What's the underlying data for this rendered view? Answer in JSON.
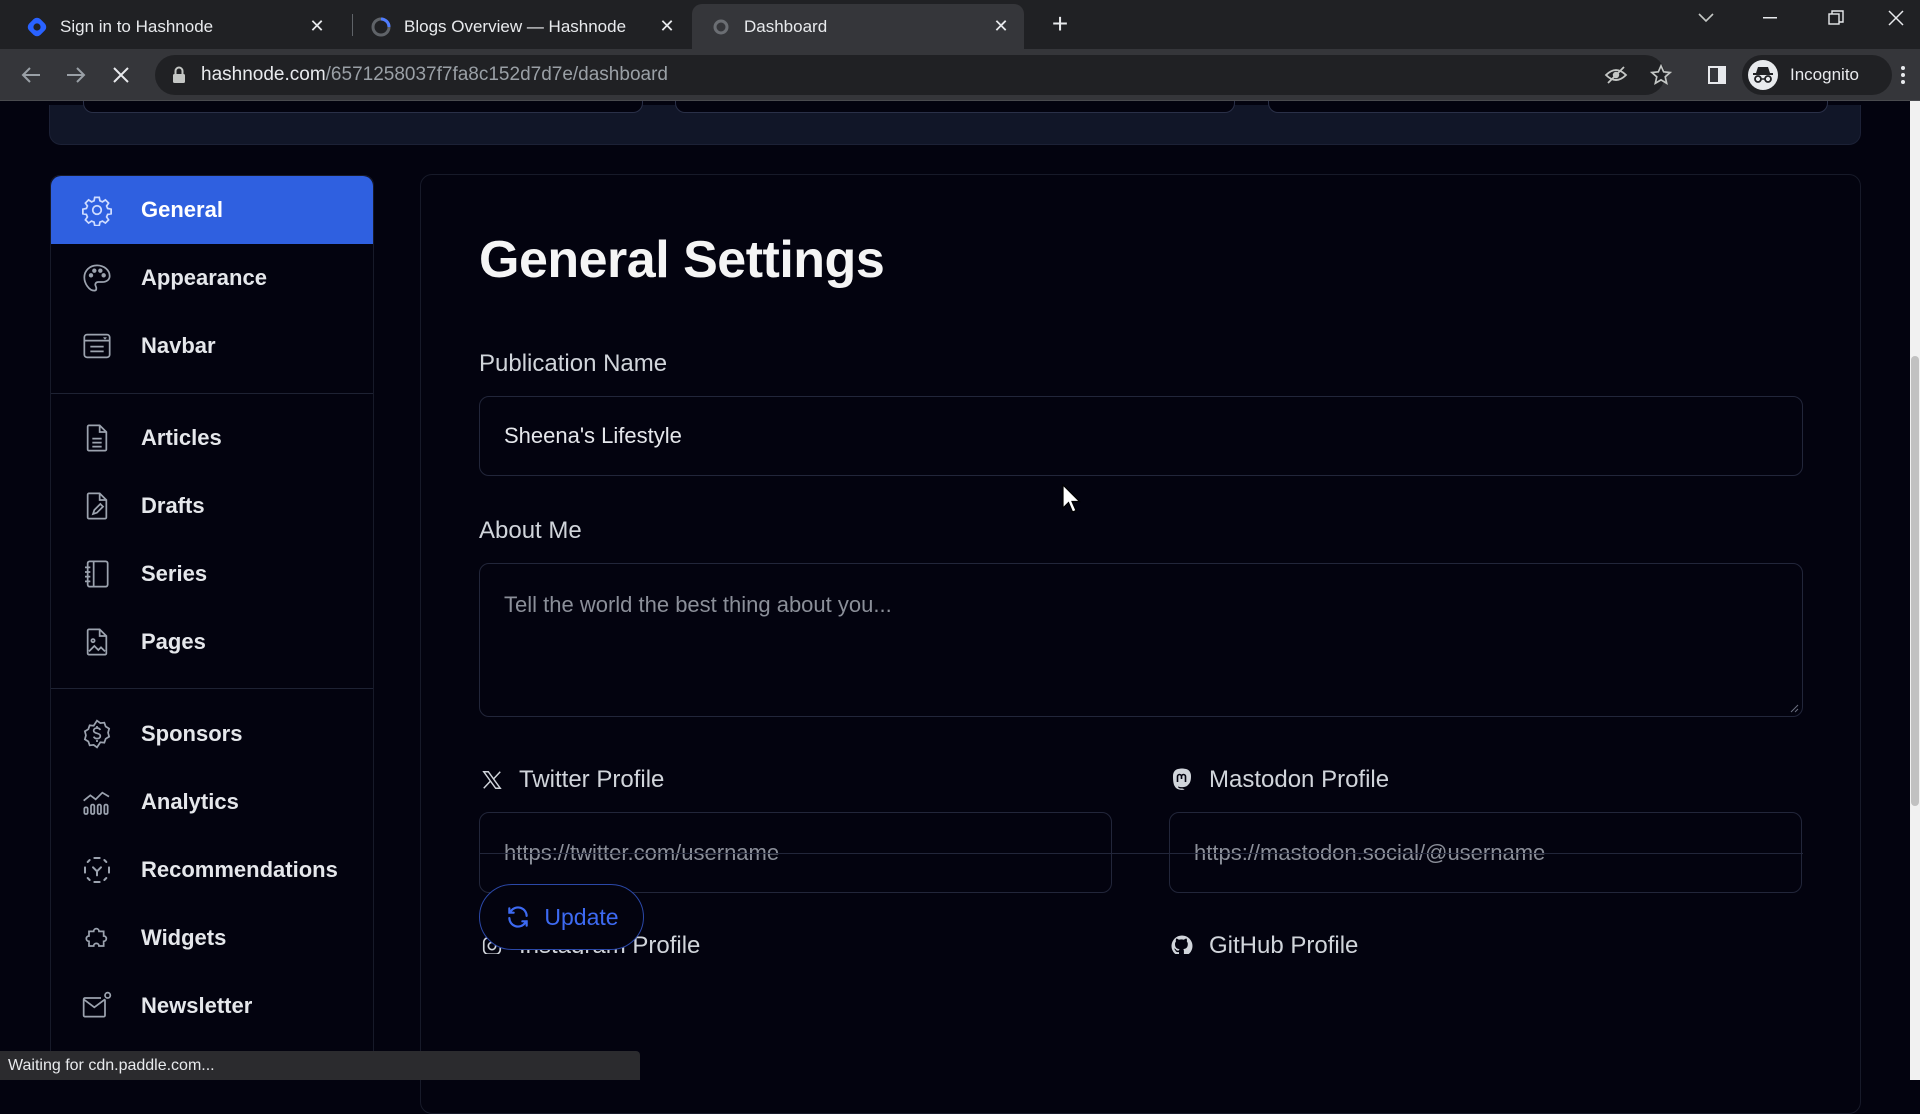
{
  "browser": {
    "tabs": [
      {
        "title": "Sign in to Hashnode",
        "icon": "hashnode-logo-icon",
        "active": false
      },
      {
        "title": "Blogs Overview — Hashnode",
        "icon": "loading-spinner-icon",
        "active": false
      },
      {
        "title": "Dashboard",
        "icon": "loading-spinner-icon",
        "active": true
      }
    ],
    "new_tab_label": "+",
    "url_host": "hashnode.com",
    "url_path": "/6571258037f7fa8c152d7d7e/dashboard",
    "profile_label": "Incognito",
    "status_text": "Waiting for cdn.paddle.com..."
  },
  "sidebar": {
    "items": [
      {
        "label": "General",
        "icon": "gear-icon",
        "active": true
      },
      {
        "label": "Appearance",
        "icon": "palette-icon",
        "active": false
      },
      {
        "label": "Navbar",
        "icon": "navbar-icon",
        "active": false
      },
      {
        "label": "Articles",
        "icon": "document-icon",
        "active": false
      },
      {
        "label": "Drafts",
        "icon": "draft-pencil-icon",
        "active": false
      },
      {
        "label": "Series",
        "icon": "notebook-icon",
        "active": false
      },
      {
        "label": "Pages",
        "icon": "page-image-icon",
        "active": false
      },
      {
        "label": "Sponsors",
        "icon": "dollar-badge-icon",
        "active": false
      },
      {
        "label": "Analytics",
        "icon": "analytics-chart-icon",
        "active": false
      },
      {
        "label": "Recommendations",
        "icon": "recommendation-icon",
        "active": false
      },
      {
        "label": "Widgets",
        "icon": "puzzle-icon",
        "active": false
      },
      {
        "label": "Newsletter",
        "icon": "mail-icon",
        "active": false
      }
    ]
  },
  "main": {
    "title": "General Settings",
    "publication_name": {
      "label": "Publication Name",
      "value": "Sheena's Lifestyle"
    },
    "about_me": {
      "label": "About Me",
      "value": "",
      "placeholder": "Tell the world the best thing about you..."
    },
    "twitter": {
      "label": "Twitter Profile",
      "value": "",
      "placeholder": "https://twitter.com/username"
    },
    "mastodon": {
      "label": "Mastodon Profile",
      "value": "",
      "placeholder": "https://mastodon.social/@username"
    },
    "instagram": {
      "label": "Instagram Profile"
    },
    "github": {
      "label": "GitHub Profile"
    },
    "update_label": "Update"
  },
  "colors": {
    "accent": "#2f60e0",
    "update_text": "#3d6af2",
    "background": "#03030f"
  }
}
